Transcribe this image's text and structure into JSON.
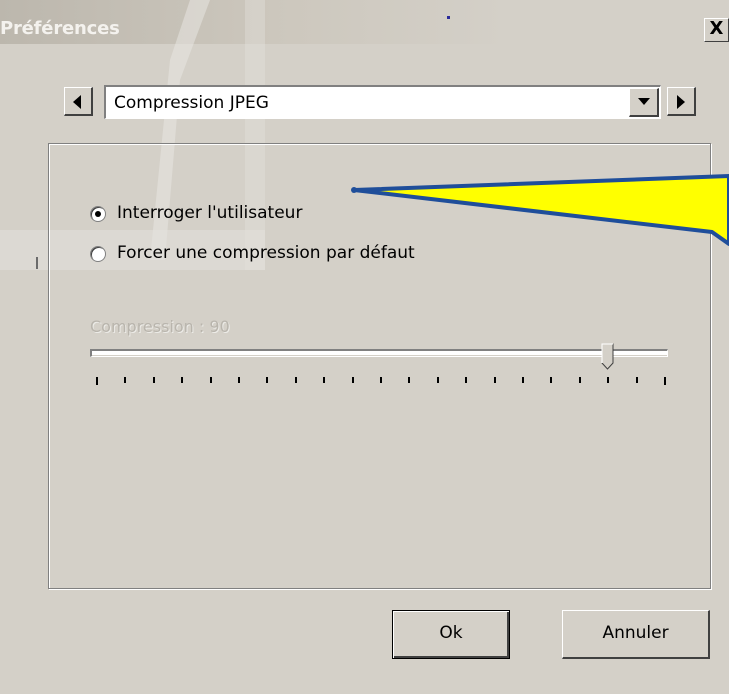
{
  "window": {
    "title": "Préférences",
    "close_glyph": "X"
  },
  "navigation": {
    "prev_icon": "left-arrow-icon",
    "next_icon": "right-arrow-icon",
    "selected_category": "Compression JPEG",
    "dropdown_icon": "chevron-down-icon"
  },
  "options": {
    "radios": [
      {
        "label": "Interroger l'utilisateur",
        "selected": true
      },
      {
        "label": "Forcer une compression par défaut",
        "selected": false
      }
    ],
    "compression_label": "Compression : 90",
    "compression_enabled": false,
    "slider": {
      "min": 0,
      "max": 100,
      "value": 90,
      "tick_count": 21
    }
  },
  "buttons": {
    "ok": "Ok",
    "cancel": "Annuler"
  },
  "colors": {
    "dialog_bg": "#d4d0c8",
    "callout_fill": "#ffff00",
    "callout_outline": "#1f4e9a",
    "disabled_text": "#b9b5ad"
  }
}
